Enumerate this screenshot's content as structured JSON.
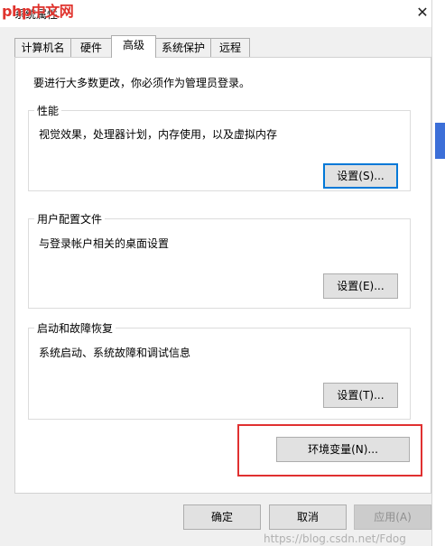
{
  "window": {
    "title": "系统属性",
    "logo_text": "php中文网",
    "close_glyph": "✕"
  },
  "tabs": [
    {
      "label": "计算机名"
    },
    {
      "label": "硬件"
    },
    {
      "label": "高级",
      "active": true
    },
    {
      "label": "系统保护"
    },
    {
      "label": "远程"
    }
  ],
  "advanced": {
    "intro": "要进行大多数更改，你必须作为管理员登录。",
    "performance": {
      "title": "性能",
      "description": "视觉效果，处理器计划，内存使用，以及虚拟内存",
      "button": "设置(S)..."
    },
    "user_profiles": {
      "title": "用户配置文件",
      "description": "与登录帐户相关的桌面设置",
      "button": "设置(E)..."
    },
    "startup_recovery": {
      "title": "启动和故障恢复",
      "description": "系统启动、系统故障和调试信息",
      "button": "设置(T)..."
    },
    "env_button": "环境变量(N)..."
  },
  "footer": {
    "ok": "确定",
    "cancel": "取消",
    "apply": "应用(A)"
  },
  "watermark": "https://blog.csdn.net/Fdog",
  "colors": {
    "focus_border": "#0078d7",
    "highlight": "#e03030",
    "logo": "#e0332d"
  }
}
